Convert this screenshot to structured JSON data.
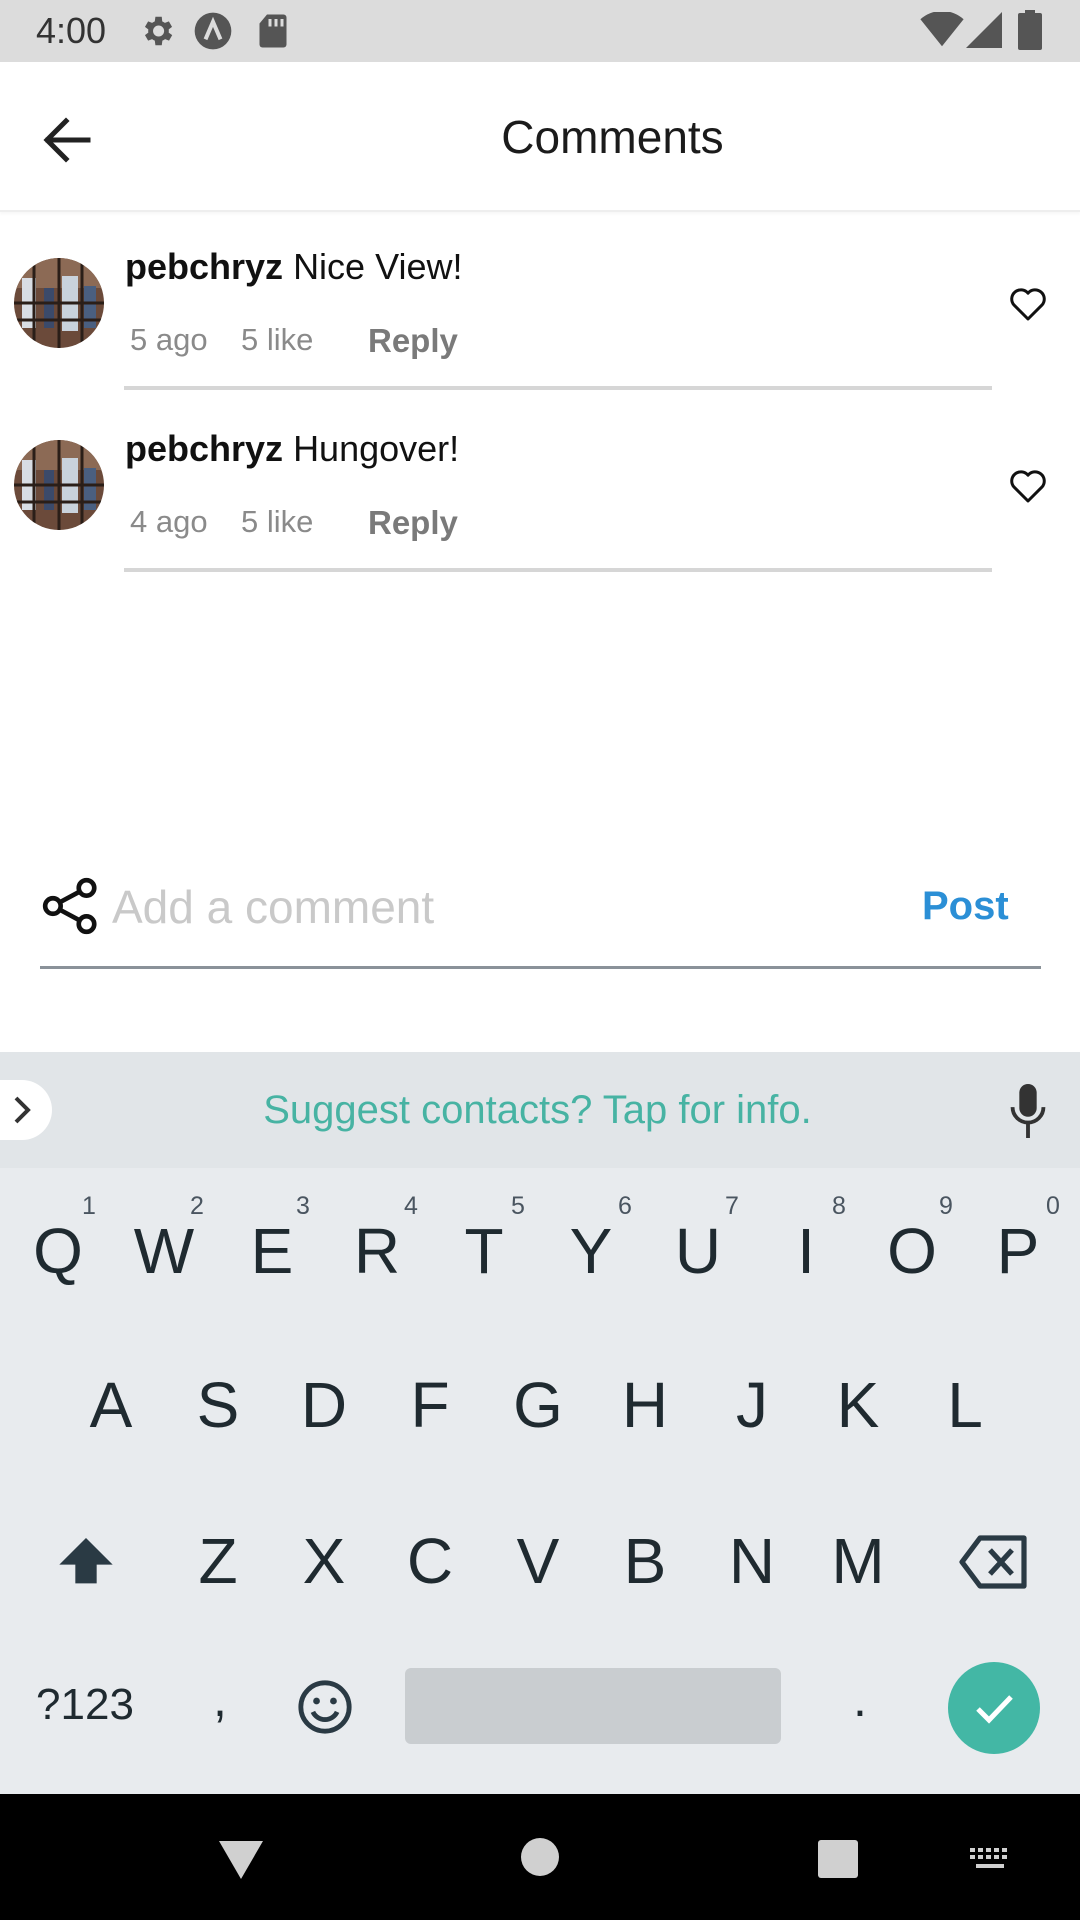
{
  "status_bar": {
    "time": "4:00",
    "icons": [
      "settings-icon",
      "a-circle-icon",
      "sd-card-icon",
      "wifi-icon",
      "signal-icon",
      "battery-icon"
    ]
  },
  "header": {
    "title": "Comments",
    "back_icon": "arrow-left-icon"
  },
  "comments": [
    {
      "username": "pebchryz",
      "text": "Nice View!",
      "time": "5 ago",
      "likes": "5 like",
      "reply": "Reply"
    },
    {
      "username": "pebchryz",
      "text": "Hungover!",
      "time": "4 ago",
      "likes": "5 like",
      "reply": "Reply"
    }
  ],
  "composer": {
    "placeholder": "Add a comment",
    "value": "",
    "post_label": "Post"
  },
  "keyboard": {
    "suggestion": "Suggest contacts? Tap for info.",
    "row1": [
      "Q",
      "W",
      "E",
      "R",
      "T",
      "Y",
      "U",
      "I",
      "O",
      "P"
    ],
    "row1_hints": [
      "1",
      "2",
      "3",
      "4",
      "5",
      "6",
      "7",
      "8",
      "9",
      "0"
    ],
    "row2": [
      "A",
      "S",
      "D",
      "F",
      "G",
      "H",
      "J",
      "K",
      "L"
    ],
    "row3": [
      "Z",
      "X",
      "C",
      "V",
      "B",
      "N",
      "M"
    ],
    "symbols_label": "?123",
    "comma": ",",
    "period": "."
  },
  "colors": {
    "accent": "#2b8fd6",
    "keyboard_accent": "#43b7a5",
    "status_bar": "#dcdcdc",
    "keyboard_bg": "#e8ebee"
  }
}
